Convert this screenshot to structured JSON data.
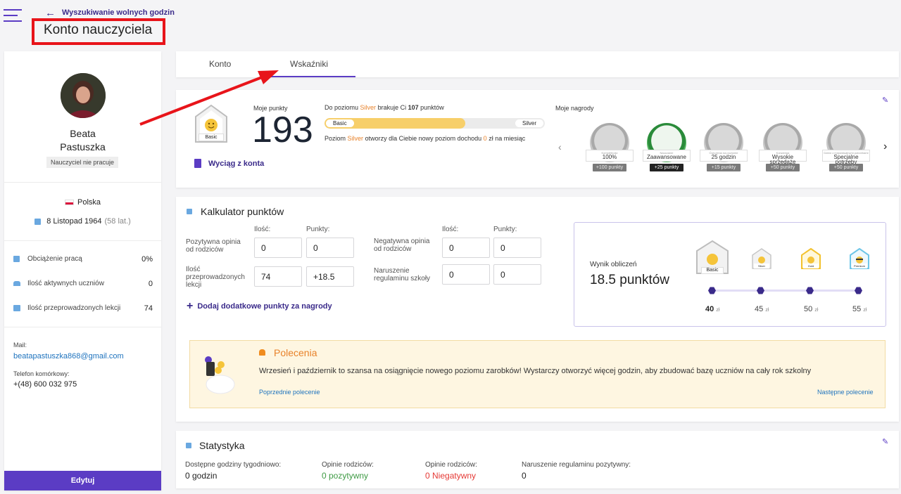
{
  "header": {
    "back_link": "Wyszukiwanie wolnych godzin",
    "page_title": "Konto nauczyciela"
  },
  "profile": {
    "first_name": "Beata",
    "last_name": "Pastuszka",
    "status": "Nauczyciel nie pracuje",
    "country": "Polska",
    "birth_date": "8 Listopad 1964",
    "age": "(58 lat.)",
    "stats": [
      {
        "label": "Obciążenie pracą",
        "value": "0%",
        "icon": "briefcase-icon"
      },
      {
        "label": "Ilość aktywnych uczniów",
        "value": "0",
        "icon": "users-icon"
      },
      {
        "label": "Ilość przeprowadzonych lekcji",
        "value": "74",
        "icon": "lessons-icon"
      }
    ],
    "mail_label": "Mail:",
    "mail": "beatapastuszka868@gmail.com",
    "phone_label": "Telefon komórkowy:",
    "phone": "+(48) 600 032 975",
    "edit_button": "Edytuj"
  },
  "tabs": [
    {
      "label": "Konto",
      "active": false
    },
    {
      "label": "Wskaźniki",
      "active": true
    }
  ],
  "points": {
    "level_badge": "Basic",
    "my_points_label": "Moje punkty",
    "my_points": "193",
    "progress_prefix": "Do poziomu",
    "progress_level": "Silver",
    "progress_mid": "brakuje Ci",
    "progress_missing": "107",
    "progress_suffix": "punktów",
    "bar_start": "Basic",
    "bar_end": "Silver",
    "progress_fraction": 0.64,
    "note_prefix": "Poziom",
    "note_level": "Silver",
    "note_mid": "otworzy dla Ciebie nowy poziom dochodu",
    "note_amount": "0",
    "note_suffix": "zł na miesiąc",
    "statement_link": "Wyciąg z konta",
    "rewards_label": "Moje nagrody",
    "rewards": [
      {
        "tiny": "Kompletność",
        "name": "100%",
        "points": "+100 punkty",
        "icon": "tools-icon",
        "earned": false
      },
      {
        "tiny": "Nauczanie",
        "name": "Zaawansowane",
        "points": "+25 punkty",
        "icon": "certificate-icon",
        "earned": true
      },
      {
        "tiny": "Ćwiczenia na poziomie",
        "name": "25 godzin",
        "points": "+15 punkty",
        "icon": "watch-icon",
        "earned": false
      },
      {
        "tiny": "Konwersja",
        "name": "Wysokie sprzedaże",
        "points": "+50 punkty",
        "icon": "money-icon",
        "earned": false
      },
      {
        "tiny": "Dzieci z indywidualnymi potrzebami",
        "name": "Specjalne potrzeby",
        "points": "+50 punkty",
        "icon": "accessibility-icon",
        "earned": false
      }
    ]
  },
  "calculator": {
    "title": "Kalkulator punktów",
    "qty_label": "Ilość:",
    "pts_label": "Punkty:",
    "rows_left": [
      {
        "label": "Pozytywna opinia od rodziców",
        "qty": "0",
        "pts": "0"
      },
      {
        "label": "Ilość przeprowadzonych lekcji",
        "qty": "74",
        "pts": "+18.5"
      }
    ],
    "rows_right": [
      {
        "label": "Negatywna opinia od rodziców",
        "qty": "0",
        "pts": "0"
      },
      {
        "label": "Naruszenie regulaminu szkoły",
        "qty": "0",
        "pts": "0"
      }
    ],
    "add_link": "Dodaj dodatkowe punkty za nagrody",
    "result_label": "Wynik obliczeń",
    "result_value": "18.5 punktów",
    "levels": [
      {
        "name": "Basic",
        "price": "40",
        "currency": "zł",
        "color": "#f5c43a"
      },
      {
        "name": "Silver",
        "price": "45",
        "currency": "zł",
        "color": "#c7c7c7"
      },
      {
        "name": "Gold",
        "price": "50",
        "currency": "zł",
        "color": "#f3c22f"
      },
      {
        "name": "Premium",
        "price": "55",
        "currency": "zł",
        "color": "#6ec6e8"
      }
    ]
  },
  "recommendation": {
    "title": "Polecenia",
    "text": "Wrzesień i październik to szansa na osiągnięcie nowego poziomu zarobków! Wystarczy otworzyć więcej godzin, aby zbudować bazę uczniów na cały rok szkolny",
    "prev": "Poprzednie polecenie",
    "next": "Następne polecenie"
  },
  "statistics": {
    "title": "Statystyka",
    "items": [
      {
        "label": "Dostępne godziny tygodniowo:",
        "value": "0 godzin",
        "color": "#222222"
      },
      {
        "label": "Opinie rodziców:",
        "value": "0 pozytywny",
        "color": "#3f9b45"
      },
      {
        "label": "Opinie rodziców:",
        "value": "0 Niegatywny",
        "color": "#e53935"
      },
      {
        "label": "Naruszenie regulaminu pozytywny:",
        "value": "0",
        "color": "#222222"
      }
    ]
  },
  "colors": {
    "accent": "#5b3cc4",
    "silver_text": "#e8822a",
    "annotation": "#e8141a",
    "progress_fill": "#f7cf6a"
  }
}
